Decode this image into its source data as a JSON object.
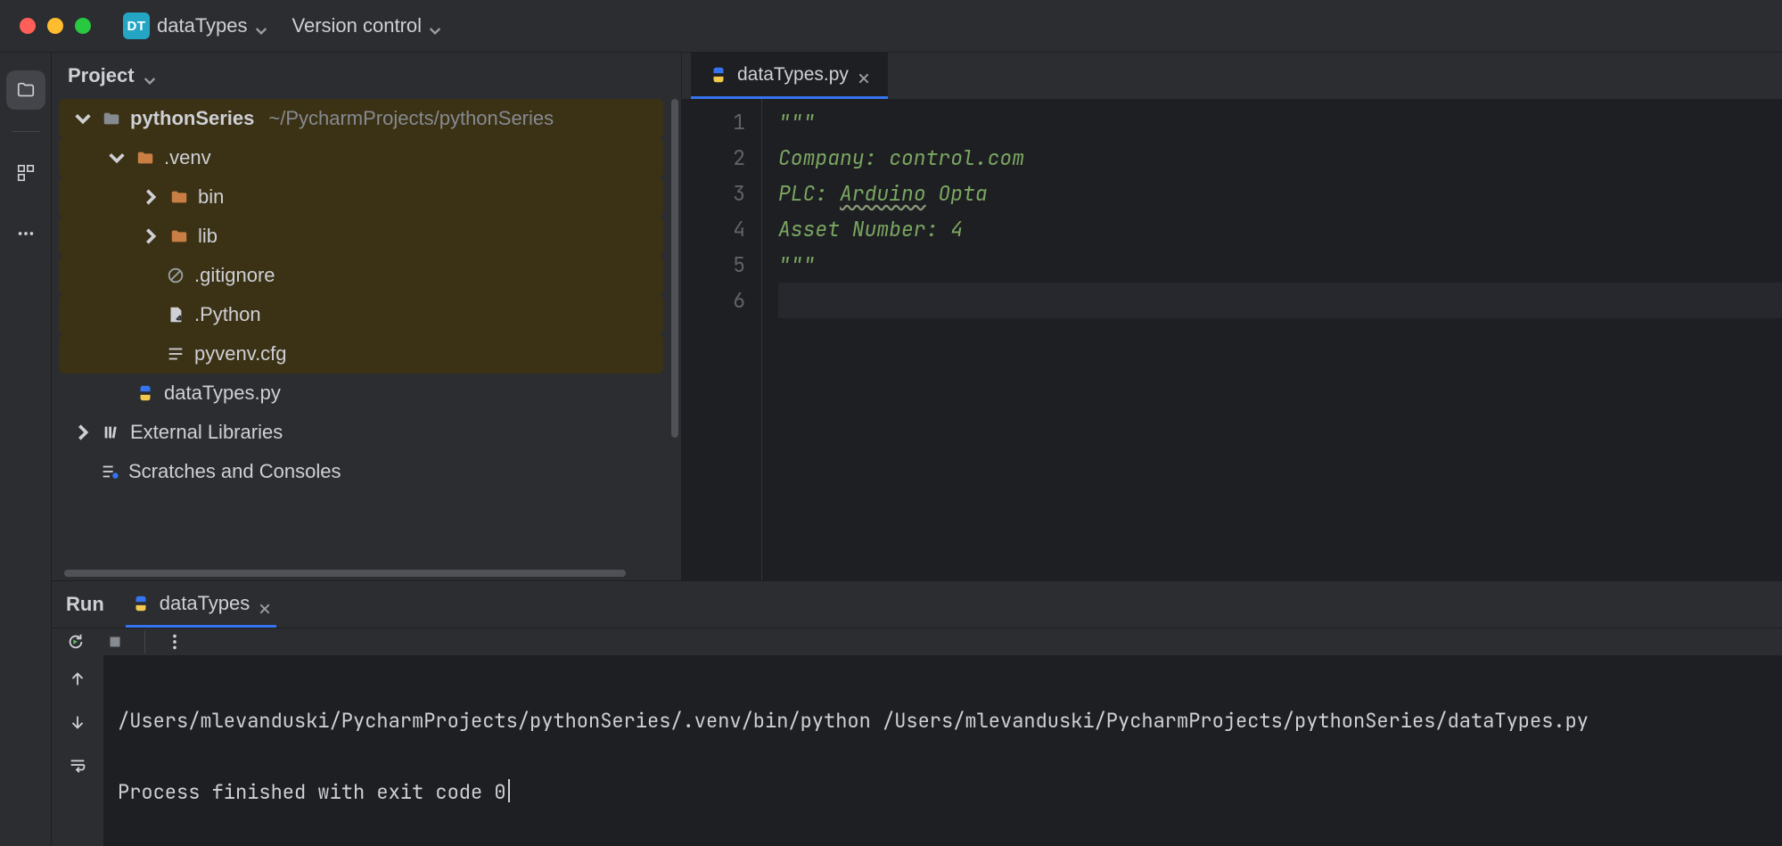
{
  "titlebar": {
    "project_badge": "DT",
    "project_name": "dataTypes",
    "menu_version_control": "Version control"
  },
  "sidebar": {
    "title": "Project",
    "root": {
      "name": "pythonSeries",
      "path": "~/PycharmProjects/pythonSeries"
    },
    "venv": {
      "name": ".venv"
    },
    "bin": {
      "name": "bin"
    },
    "lib": {
      "name": "lib"
    },
    "gitignore": {
      "name": ".gitignore"
    },
    "dotpython": {
      "name": ".Python"
    },
    "pyvenv": {
      "name": "pyvenv.cfg"
    },
    "datafile": {
      "name": "dataTypes.py"
    },
    "ext_libs": {
      "name": "External Libraries"
    },
    "scratches": {
      "name": "Scratches and Consoles"
    }
  },
  "editor": {
    "tab_name": "dataTypes.py",
    "lines": {
      "l1": "\"\"\"",
      "l2_a": "Company: ",
      "l2_b": "control.com",
      "l3_a": "PLC: ",
      "l3_b": "Arduino",
      "l3_c": " Opta",
      "l4": "Asset Number: 4",
      "l5": "\"\"\"",
      "l6": ""
    },
    "gutter": [
      "1",
      "2",
      "3",
      "4",
      "5",
      "6"
    ]
  },
  "run_panel": {
    "run_label": "Run",
    "tab_name": "dataTypes",
    "cmdline": "/Users/mlevanduski/PycharmProjects/pythonSeries/.venv/bin/python /Users/mlevanduski/PycharmProjects/pythonSeries/dataTypes.py",
    "exitline": "Process finished with exit code 0"
  }
}
